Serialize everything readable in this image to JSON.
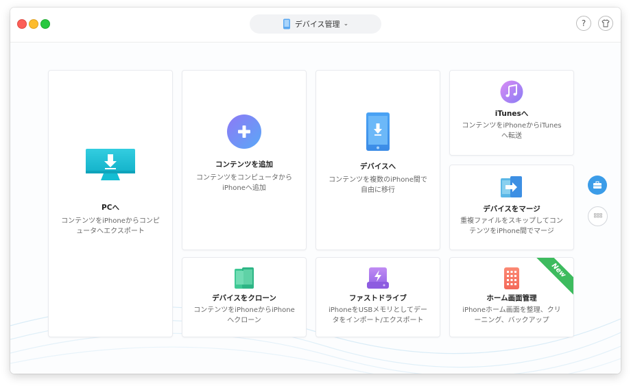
{
  "titlebar": {
    "device_name": "デバイス管理",
    "help_label": "?"
  },
  "colors": {
    "accent": "#3b9ce8",
    "new_badge": "#3dbb5e"
  },
  "cards": {
    "to_pc": {
      "title": "PCへ",
      "desc": "コンテンツをiPhoneからコンピュータへエクスポート",
      "icon": "monitor-download-icon"
    },
    "add_content": {
      "title": "コンテンツを追加",
      "desc": "コンテンツをコンピュータからiPhoneへ追加",
      "icon": "plus-circle-icon"
    },
    "to_device": {
      "title": "デバイスへ",
      "desc": "コンテンツを複数のiPhone間で自由に移行",
      "icon": "phone-download-icon"
    },
    "to_itunes": {
      "title": "iTunesへ",
      "desc": "コンテンツをiPhoneからiTunesへ転送",
      "icon": "music-note-icon"
    },
    "merge_device": {
      "title": "デバイスをマージ",
      "desc": "重複ファイルをスキップしてコンテンツをiPhone間でマージ",
      "icon": "merge-phones-icon"
    },
    "clone_device": {
      "title": "デバイスをクローン",
      "desc": "コンテンツをiPhoneからiPhoneへクローン",
      "icon": "clone-phones-icon"
    },
    "fast_drive": {
      "title": "ファストドライブ",
      "desc": "iPhoneをUSBメモリとしてデータをインポート/エクスポート",
      "icon": "lightning-drive-icon"
    },
    "home_screen": {
      "title": "ホーム画面管理",
      "desc": "iPhoneホーム画面を整理、クリーニング、バックアップ",
      "icon": "app-grid-phone-icon",
      "badge": "New"
    }
  },
  "sidebar": {
    "toolbox_icon": "toolbox-icon",
    "grid_icon": "grid-icon"
  }
}
